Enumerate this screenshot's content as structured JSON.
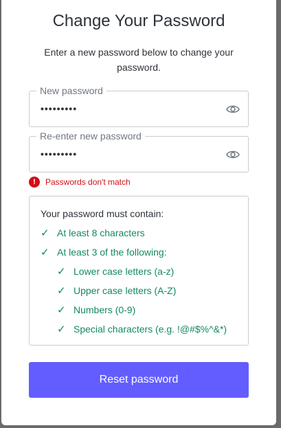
{
  "page": {
    "title": "Change Your Password",
    "subtitle": "Enter a new password below to change your password."
  },
  "fields": {
    "new_password": {
      "label": "New password",
      "value": "•••••••••"
    },
    "reenter_password": {
      "label": "Re-enter new password",
      "value": "•••••••••"
    }
  },
  "error": {
    "icon": "!",
    "message": "Passwords don't match"
  },
  "requirements": {
    "title": "Your password must contain:",
    "check_glyph": "✓",
    "items": [
      {
        "text": "At least 8 characters",
        "met": true
      },
      {
        "text": "At least 3 of the following:",
        "met": true
      },
      {
        "text": "Lower case letters (a-z)",
        "met": true
      },
      {
        "text": "Upper case letters (A-Z)",
        "met": true
      },
      {
        "text": "Numbers (0-9)",
        "met": true
      },
      {
        "text": "Special characters (e.g. !@#$%^&*)",
        "met": true
      }
    ]
  },
  "submit": {
    "label": "Reset password"
  },
  "icons": {
    "password_toggle": "eye-icon",
    "error": "error-circle-icon",
    "check": "check-icon"
  },
  "colors": {
    "accent": "#635dff",
    "error": "#d00e17",
    "success": "#138a5b",
    "border": "#c9cace"
  }
}
